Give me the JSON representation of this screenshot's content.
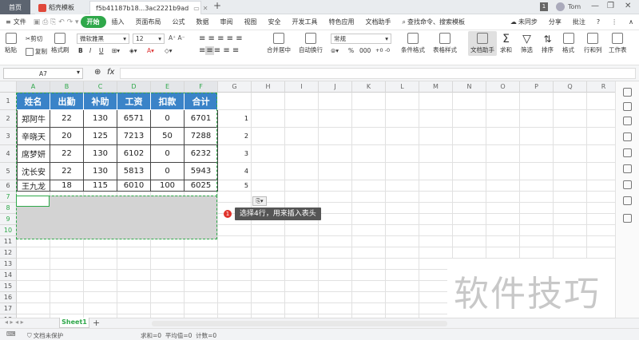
{
  "titlebar": {
    "home_tab": "首页",
    "tab1": "稻壳模板",
    "tab2": "f5b41187b18...3ac2221b9ad",
    "add_tab": "+",
    "badge": "1",
    "user": "Tom",
    "minimize": "—",
    "restore": "❐",
    "close": "✕"
  },
  "menubar": {
    "file": "文件",
    "items": [
      "开始",
      "插入",
      "页面布局",
      "公式",
      "数据",
      "审阅",
      "视图",
      "安全",
      "开发工具",
      "特色应用",
      "文档助手"
    ],
    "search": "查找命令、搜索模板",
    "unsync": "未同步",
    "share": "分享",
    "comment": "批注",
    "help": "?"
  },
  "ribbon": {
    "paste": "粘贴",
    "cut": "剪切",
    "copy": "复制",
    "format_painter": "格式刷",
    "font_name": "微软雅黑",
    "font_size": "12",
    "bold": "B",
    "italic": "I",
    "underline": "U",
    "merge_center": "合并居中",
    "wrap_text": "自动换行",
    "number_format": "常规",
    "percent": "%",
    "thousands": "000",
    "cond_format": "条件格式",
    "table_style": "表格样式",
    "doc_assistant": "文档助手",
    "sum": "求和",
    "filter": "筛选",
    "sort": "排序",
    "format": "格式",
    "rows_cols": "行和列",
    "worksheet": "工作表"
  },
  "formula_bar": {
    "name_box": "A7",
    "fx": "fx",
    "content": ""
  },
  "columns": [
    "A",
    "B",
    "C",
    "D",
    "E",
    "F",
    "G",
    "H",
    "I",
    "J",
    "K",
    "L",
    "M",
    "N",
    "O",
    "P",
    "Q",
    "R"
  ],
  "rows": [
    "1",
    "2",
    "3",
    "4",
    "5",
    "6",
    "7",
    "8",
    "9",
    "10",
    "11",
    "12",
    "13",
    "14",
    "15",
    "16",
    "17",
    "18",
    "19"
  ],
  "table": {
    "headers": [
      "姓名",
      "出勤",
      "补助",
      "工资",
      "扣款",
      "合计"
    ],
    "data": [
      [
        "郑阿牛",
        "22",
        "130",
        "6571",
        "0",
        "6701"
      ],
      [
        "辛晓天",
        "20",
        "125",
        "7213",
        "50",
        "7288"
      ],
      [
        "席梦妍",
        "22",
        "130",
        "6102",
        "0",
        "6232"
      ],
      [
        "沈长安",
        "22",
        "130",
        "5813",
        "0",
        "5943"
      ],
      [
        "王九龙",
        "18",
        "115",
        "6010",
        "100",
        "6025"
      ]
    ]
  },
  "g_column": [
    "1",
    "2",
    "3",
    "4",
    "5"
  ],
  "annotation": {
    "number": "1",
    "text": "选择4行，用来插入表头"
  },
  "watermark": "软件技巧",
  "sheets": {
    "active": "Sheet1",
    "add": "+"
  },
  "status": {
    "protect": "文档未保护",
    "stats": "求和=0  平均值=0  计数=0"
  },
  "colors": {
    "header_fill": "#3a83c8",
    "accent_green": "#2fa84a",
    "selection_fill": "#d3d3d3",
    "annotation_badge": "#e0322b",
    "annotation_bg": "#555555"
  }
}
